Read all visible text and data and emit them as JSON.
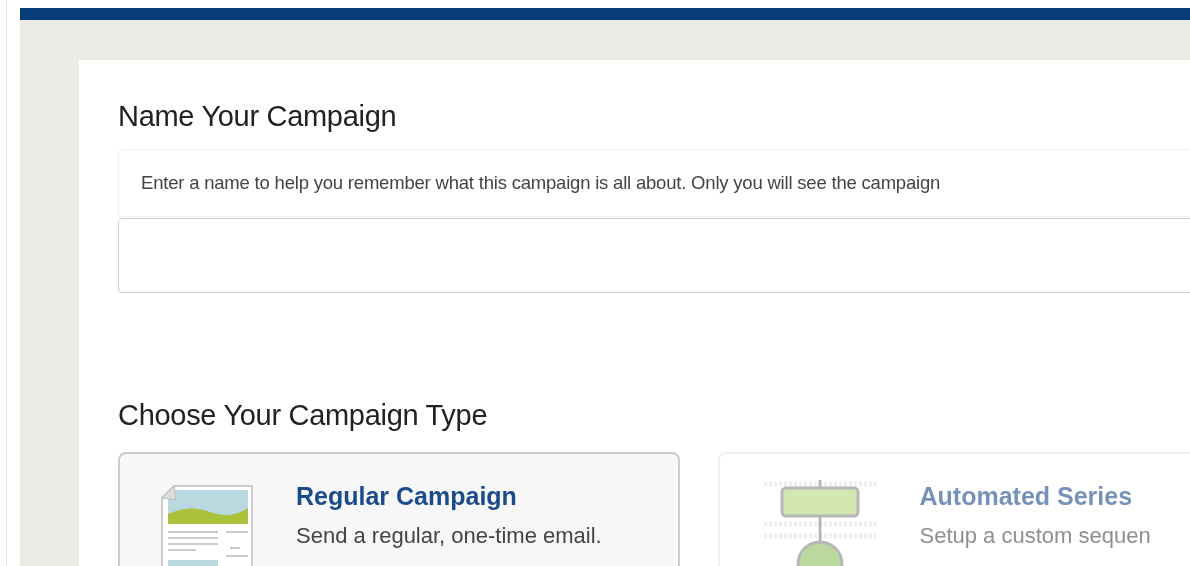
{
  "name_section": {
    "title": "Name Your Campaign",
    "hint": "Enter a name to help you remember what this campaign is all about. Only you will see the campaign"
  },
  "type_section": {
    "title": "Choose Your Campaign Type",
    "options": [
      {
        "kind": "regular",
        "title": "Regular Campaign",
        "description": "Send a regular, one-time email.",
        "selected": true
      },
      {
        "kind": "automated",
        "title": "Automated Series",
        "description": "Setup a custom sequen",
        "selected": false
      }
    ]
  }
}
